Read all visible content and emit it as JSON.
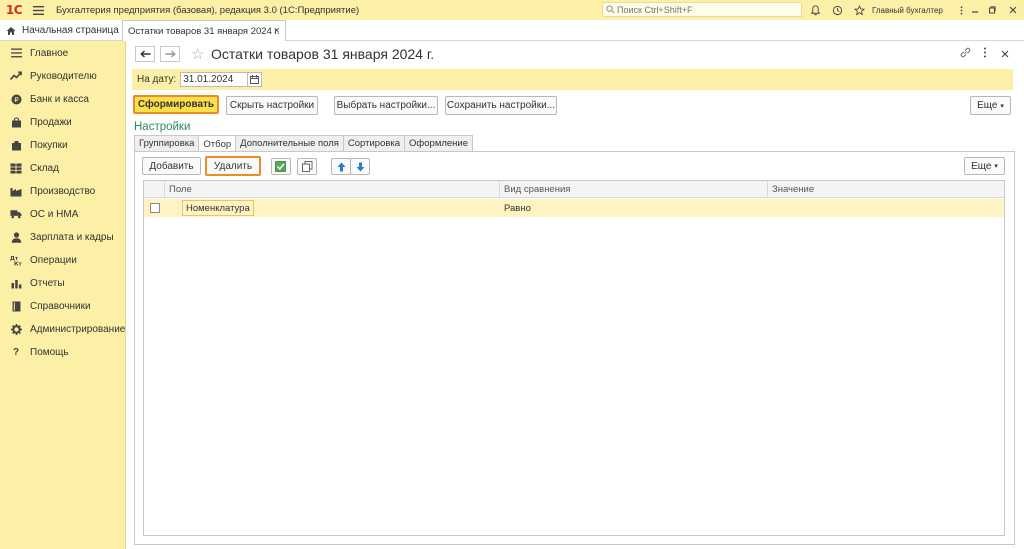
{
  "app": {
    "logo_text": "1С",
    "title": "Бухгалтерия предприятия (базовая), редакция 3.0  (1С:Предприятие)",
    "search_placeholder": "Поиск Ctrl+Shift+F",
    "user": "Главный бухгалтер",
    "icons": [
      "bell-icon",
      "history-icon",
      "star-icon",
      "minimize-icon",
      "restore-icon",
      "close-icon"
    ]
  },
  "tabs": {
    "home": "Начальная страница",
    "document": "Остатки товаров 31 января 2024 г."
  },
  "sidebar": {
    "items": [
      {
        "label": "Главное",
        "icon": "menu-icon"
      },
      {
        "label": "Руководителю",
        "icon": "trend-icon"
      },
      {
        "label": "Банк и касса",
        "icon": "coin-icon"
      },
      {
        "label": "Продажи",
        "icon": "bag-icon"
      },
      {
        "label": "Покупки",
        "icon": "cart-icon"
      },
      {
        "label": "Склад",
        "icon": "warehouse-icon"
      },
      {
        "label": "Производство",
        "icon": "factory-icon"
      },
      {
        "label": "ОС и НМА",
        "icon": "truck-icon"
      },
      {
        "label": "Зарплата и кадры",
        "icon": "person-icon"
      },
      {
        "label": "Операции",
        "icon": "operations-icon"
      },
      {
        "label": "Отчеты",
        "icon": "chart-icon"
      },
      {
        "label": "Справочники",
        "icon": "book-icon"
      },
      {
        "label": "Администрирование",
        "icon": "gear-icon"
      },
      {
        "label": "Помощь",
        "icon": "help-icon"
      }
    ]
  },
  "report": {
    "title": "Остатки товаров 31 января 2024 г.",
    "date_label": "На дату:",
    "date_value": "31.01.2024",
    "buttons": {
      "generate": "Сформировать",
      "hide_settings": "Скрыть настройки",
      "choose_settings": "Выбрать настройки...",
      "save_settings": "Сохранить настройки...",
      "more": "Еще"
    },
    "settings_label": "Настройки",
    "settings_tabs": [
      "Группировка",
      "Отбор",
      "Дополнительные поля",
      "Сортировка",
      "Оформление"
    ],
    "active_tab": "Отбор",
    "filter_toolbar": {
      "add": "Добавить",
      "delete": "Удалить",
      "more": "Еще"
    },
    "grid": {
      "columns": [
        "Поле",
        "Вид сравнения",
        "Значение"
      ],
      "rows": [
        {
          "checked": false,
          "field": "Номенклатура",
          "comparison": "Равно",
          "value": ""
        }
      ]
    }
  }
}
